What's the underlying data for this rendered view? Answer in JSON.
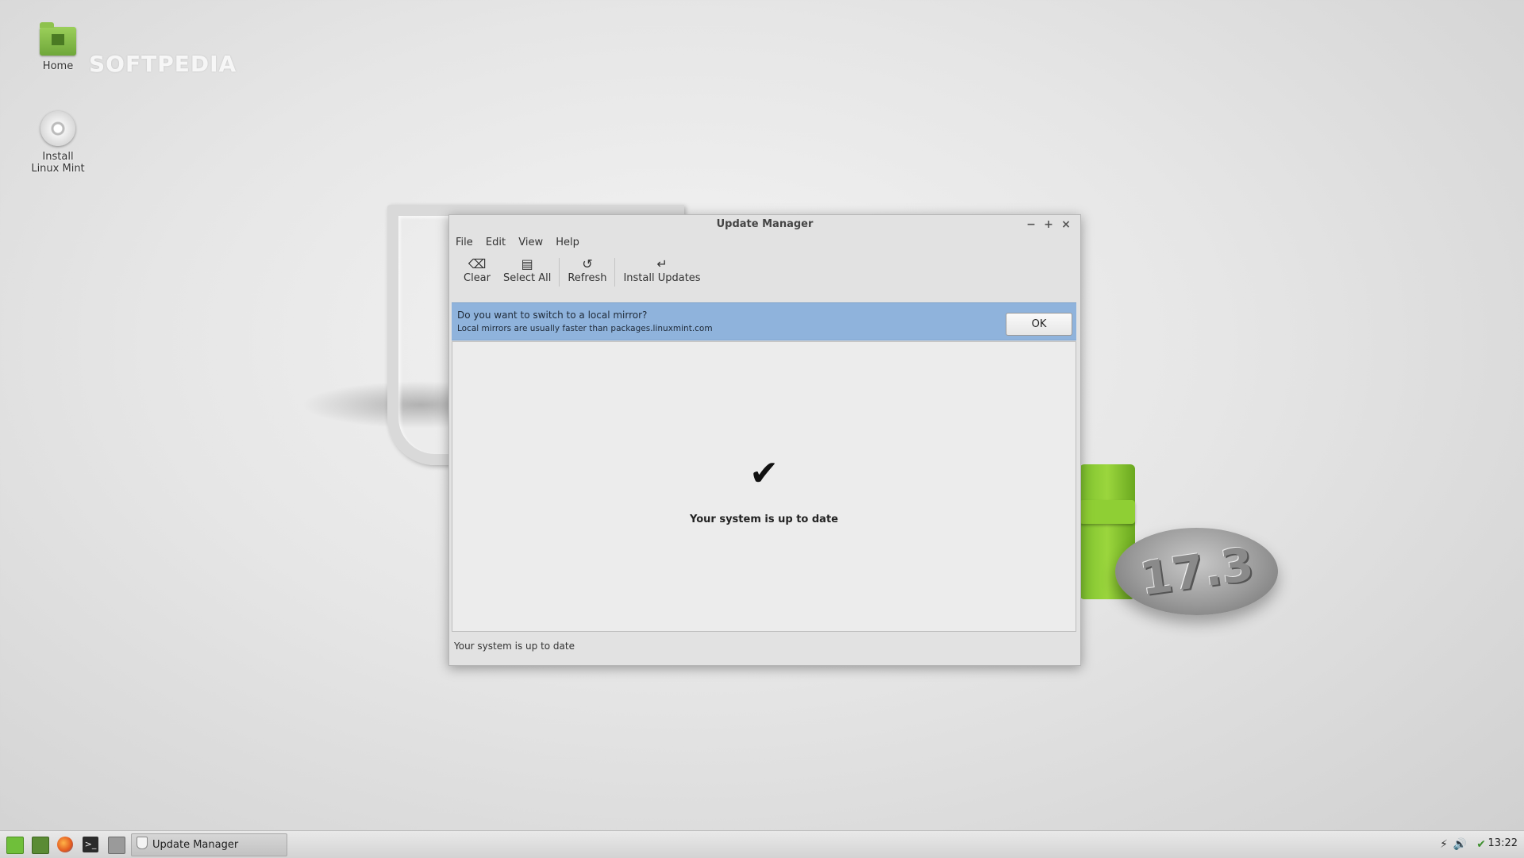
{
  "desktop": {
    "watermark": "SOFTPEDIA",
    "icons": [
      {
        "label": "Home",
        "icon": "home-folder-icon"
      },
      {
        "label": "Install Linux Mint",
        "icon": "disc-icon"
      }
    ],
    "wallpaper_badge": "17.3"
  },
  "window": {
    "title": "Update Manager",
    "controls": {
      "minimize": "−",
      "maximize": "+",
      "close": "×"
    },
    "menu": [
      "File",
      "Edit",
      "View",
      "Help"
    ],
    "toolbar": [
      {
        "label": "Clear",
        "icon": "clear-icon"
      },
      {
        "label": "Select All",
        "icon": "select-all-icon"
      },
      {
        "label": "Refresh",
        "icon": "refresh-icon"
      },
      {
        "label": "Install Updates",
        "icon": "install-icon"
      }
    ],
    "infobar": {
      "title": "Do you want to switch to a local mirror?",
      "subtitle": "Local mirrors are usually faster than packages.linuxmint.com",
      "ok_label": "OK",
      "color": "#8fb3dc"
    },
    "content": {
      "status_icon": "checkmark-icon",
      "message": "Your system is up to date"
    },
    "statusbar": "Your system is up to date"
  },
  "taskbar": {
    "launchers": [
      "mint-menu-icon",
      "show-desktop-icon",
      "firefox-icon",
      "terminal-icon",
      "files-icon"
    ],
    "active_task": "Update Manager",
    "tray": [
      "network-icon",
      "volume-icon",
      "update-shield-icon"
    ],
    "clock": "13:22"
  }
}
